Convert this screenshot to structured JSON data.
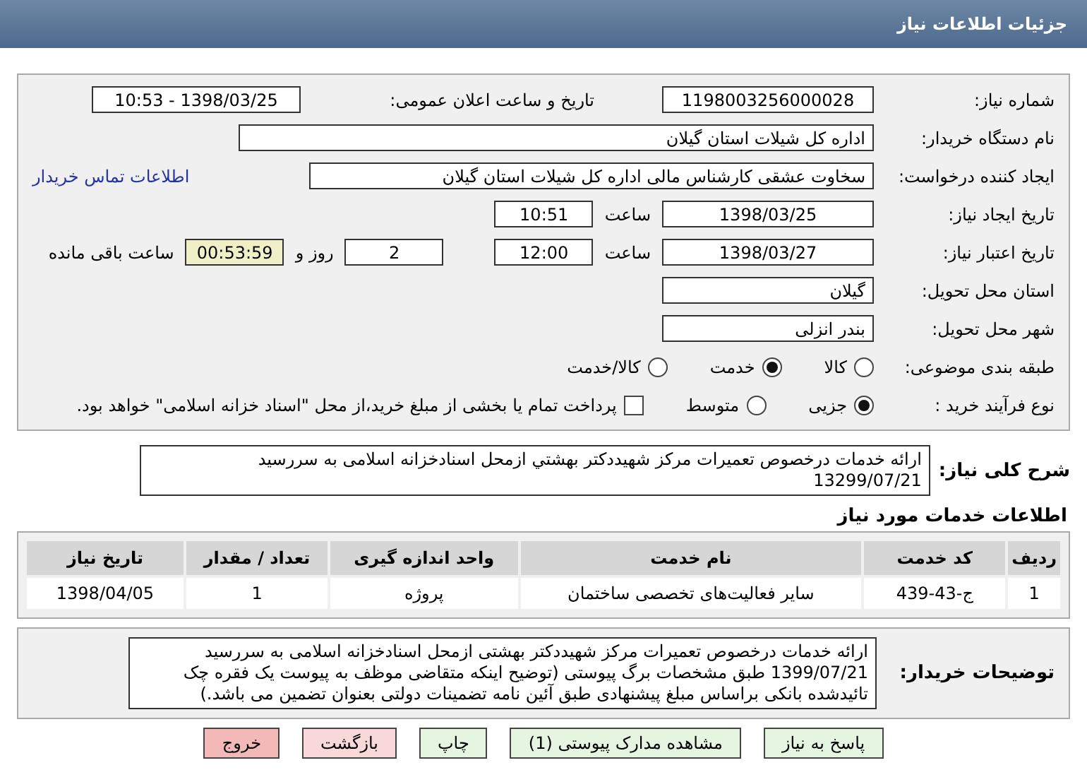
{
  "header": {
    "title": "جزئیات اطلاعات نیاز"
  },
  "need_number": {
    "label": "شماره نیاز:",
    "value": "1198003256000028"
  },
  "announce": {
    "label": "تاریخ و ساعت اعلان عمومی:",
    "value": "1398/03/25 - 10:53"
  },
  "buyer_org": {
    "label": "نام دستگاه خریدار:",
    "value": "اداره کل شیلات استان گیلان"
  },
  "requester": {
    "label": "ایجاد کننده درخواست:",
    "value": "سخاوت  عشقی  کارشناس مالی  اداره کل شیلات استان گیلان",
    "link": "اطلاعات تماس خریدار"
  },
  "created": {
    "label": "تاریخ ایجاد نیاز:",
    "date": "1398/03/25",
    "time_label": "ساعت",
    "time": "10:51"
  },
  "validity": {
    "label": "تاریخ اعتبار نیاز:",
    "date": "1398/03/27",
    "time_label": "ساعت",
    "time": "12:00",
    "days": "2",
    "days_label": "روز و",
    "remaining": "00:53:59",
    "remaining_label": "ساعت باقی مانده"
  },
  "province": {
    "label": "استان محل تحویل:",
    "value": "گیلان"
  },
  "city": {
    "label": "شهر محل تحویل:",
    "value": "بندر انزلی"
  },
  "category": {
    "label": "طبقه بندی موضوعی:",
    "options": [
      {
        "label": "کالا",
        "selected": false
      },
      {
        "label": "خدمت",
        "selected": true
      },
      {
        "label": "کالا/خدمت",
        "selected": false
      }
    ]
  },
  "process": {
    "label": "نوع فرآیند خرید :",
    "options": [
      {
        "label": "جزیی",
        "selected": true
      },
      {
        "label": "متوسط",
        "selected": false
      }
    ],
    "payment": {
      "label": "پرداخت تمام یا بخشی از مبلغ خرید،از محل \"اسناد خزانه اسلامی\" خواهد بود.",
      "checked": false
    }
  },
  "summary": {
    "label": "شرح کلی نیاز:",
    "text": "ارائه خدمات درخصوص تعمیرات مرکز شهیددکتر بهشتي ازمحل اسنادخزانه اسلامی به سررسید 13299/07/21"
  },
  "services": {
    "title": "اطلاعات خدمات مورد نیاز",
    "columns": [
      "ردیف",
      "کد خدمت",
      "نام خدمت",
      "واحد اندازه گیری",
      "تعداد / مقدار",
      "تاریخ نیاز"
    ],
    "rows": [
      [
        "1",
        "ج-43-439",
        "سایر فعالیت‌های تخصصی ساختمان",
        "پروژه",
        "1",
        "1398/04/05"
      ]
    ]
  },
  "notes": {
    "label": "توضیحات خریدار:",
    "text": "ارائه خدمات درخصوص تعمیرات مرکز شهیددکتر بهشتی ازمحل اسنادخزانه اسلامی به سررسید 1399/07/21 طبق مشخصات برگ پیوستی (توضیح اینکه متقاضی موظف به پیوست یک فقره چک تائیدشده بانکی براساس مبلغ پیشنهادی طبق آئین نامه تضمینات دولتی بعنوان تضمین می باشد.)"
  },
  "buttons": [
    {
      "label": "پاسخ به نیاز",
      "kind": "green"
    },
    {
      "label": "مشاهده مدارک پیوستی (1)",
      "kind": "green"
    },
    {
      "label": "چاپ",
      "kind": "green"
    },
    {
      "label": "بازگشت",
      "kind": "pink"
    },
    {
      "label": "خروج",
      "kind": "red"
    }
  ]
}
